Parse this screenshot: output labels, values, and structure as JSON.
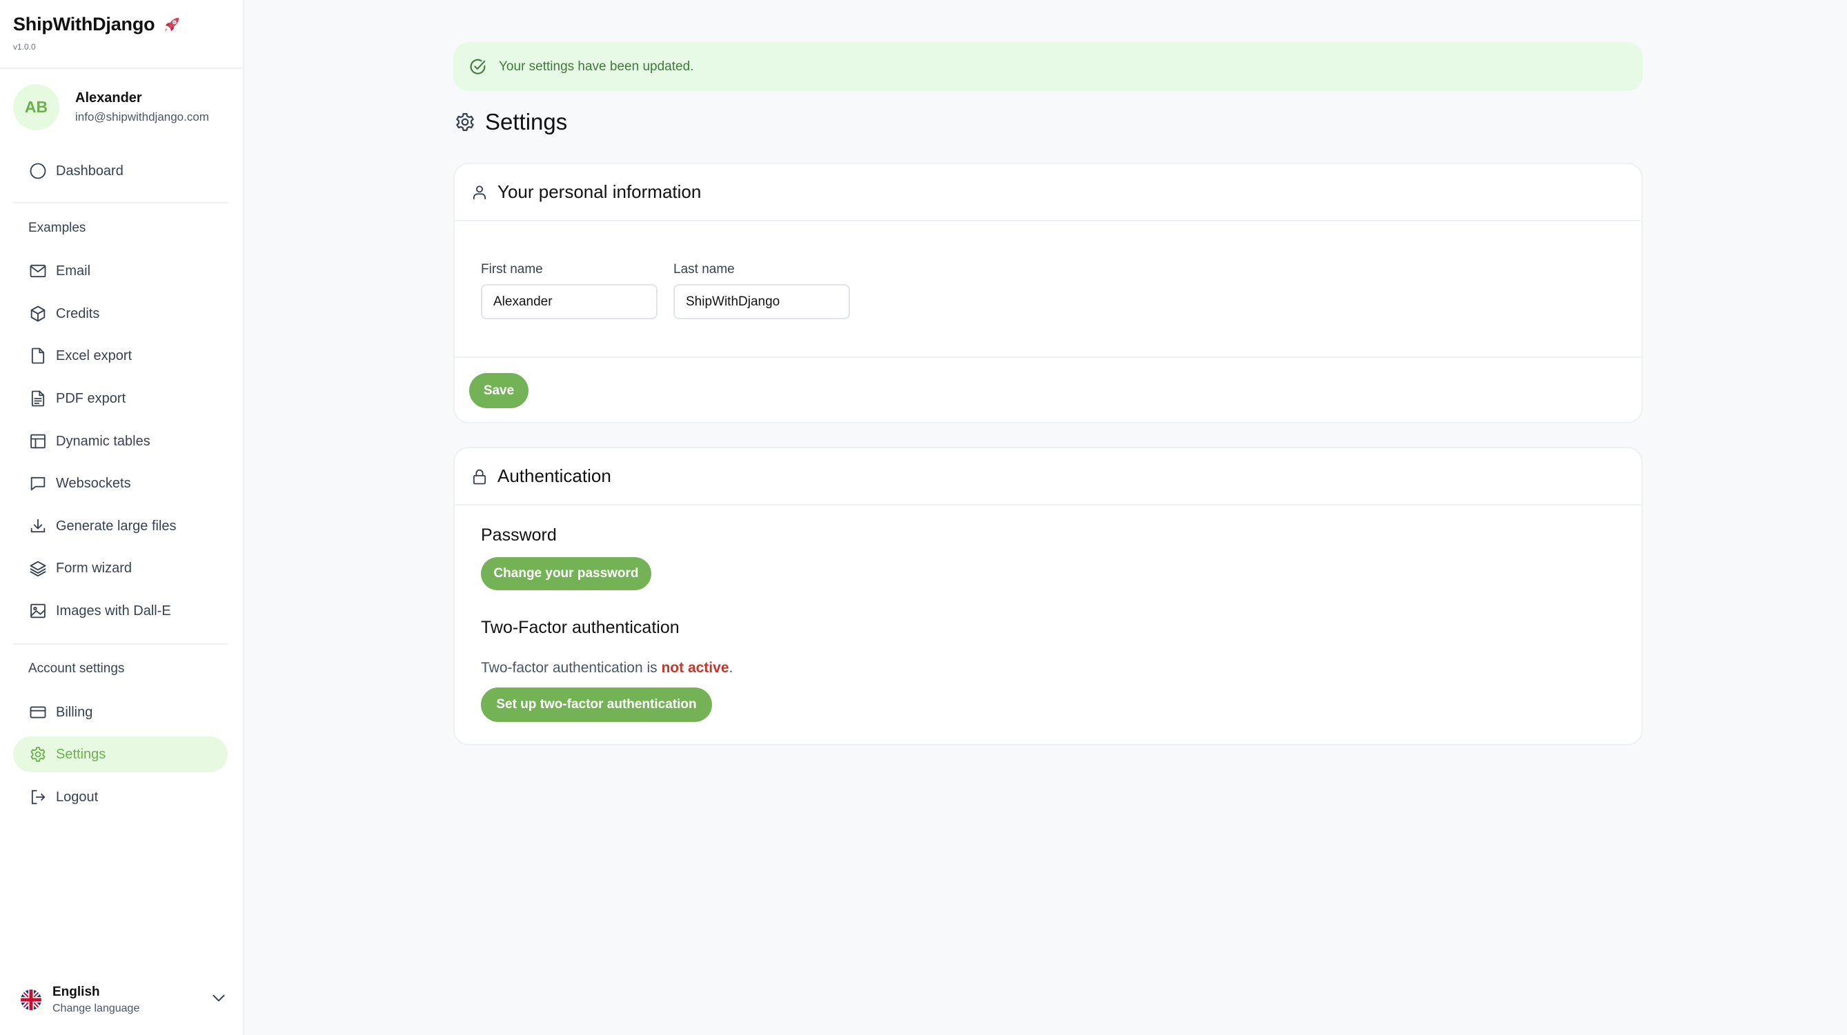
{
  "app": {
    "title": "ShipWithDjango",
    "version": "v1.0.0"
  },
  "user": {
    "initials": "AB",
    "name": "Alexander",
    "email": "info@shipwithdjango.com"
  },
  "sidebar": {
    "dashboard": {
      "label": "Dashboard",
      "icon": "circle-icon"
    },
    "examples_heading": "Examples",
    "examples": [
      {
        "label": "Email",
        "icon": "mail-icon"
      },
      {
        "label": "Credits",
        "icon": "cube-icon"
      },
      {
        "label": "Excel export",
        "icon": "file-icon"
      },
      {
        "label": "PDF export",
        "icon": "document-text-icon"
      },
      {
        "label": "Dynamic tables",
        "icon": "table-icon"
      },
      {
        "label": "Websockets",
        "icon": "chat-bubble-icon"
      },
      {
        "label": "Generate large files",
        "icon": "download-icon"
      },
      {
        "label": "Form wizard",
        "icon": "layers-icon"
      },
      {
        "label": "Images with Dall-E",
        "icon": "image-icon"
      }
    ],
    "account_heading": "Account settings",
    "account": [
      {
        "label": "Billing",
        "icon": "credit-card-icon"
      },
      {
        "label": "Settings",
        "icon": "gear-icon",
        "active": true
      },
      {
        "label": "Logout",
        "icon": "logout-icon"
      }
    ]
  },
  "language": {
    "name": "English",
    "subtitle": "Change language",
    "flag": "uk-flag-icon"
  },
  "alert": {
    "message": "Your settings have been updated.",
    "type": "success"
  },
  "page": {
    "title": "Settings"
  },
  "personal": {
    "title": "Your personal information",
    "first_name_label": "First name",
    "first_name_value": "Alexander",
    "last_name_label": "Last name",
    "last_name_value": "ShipWithDjango",
    "save_label": "Save"
  },
  "auth": {
    "title": "Authentication",
    "password_heading": "Password",
    "change_password_label": "Change your password",
    "twofa_heading": "Two-Factor authentication",
    "twofa_status_prefix": "Two-factor authentication is ",
    "twofa_status_value": "not active",
    "twofa_status_suffix": ".",
    "setup_twofa_label": "Set up two-factor authentication"
  },
  "colors": {
    "accent": "#74b355",
    "accent_text": "#6ab04c",
    "accent_bg": "#e7fae1",
    "alert_bg": "#e6fae6",
    "alert_text": "#3f7a3a",
    "danger": "#c0392b"
  }
}
